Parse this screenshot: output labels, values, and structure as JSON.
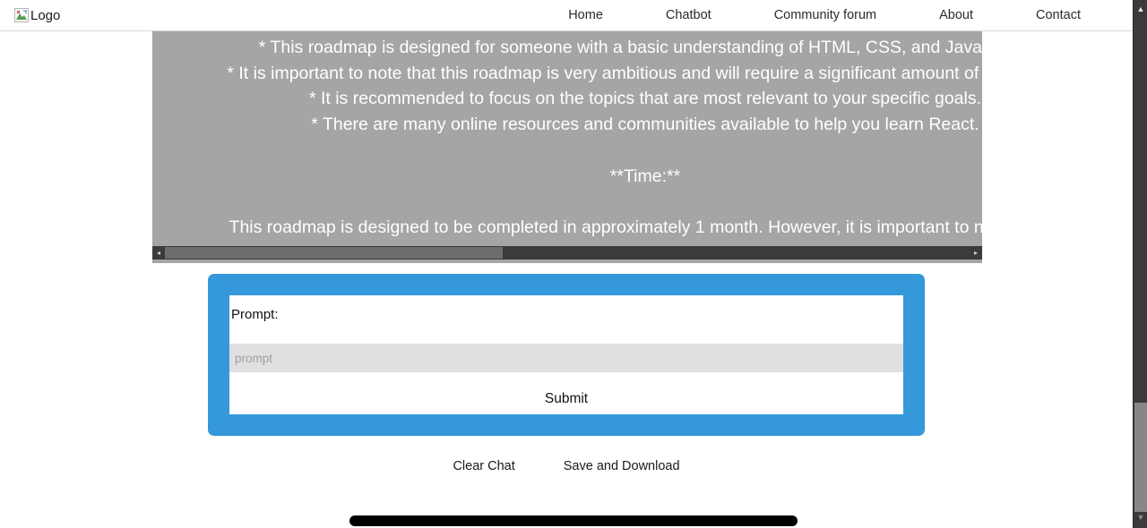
{
  "header": {
    "logo_alt": "Logo",
    "logo_icon": "broken-image-icon",
    "nav": [
      {
        "label": "Home"
      },
      {
        "label": "Chatbot"
      },
      {
        "label": "Community forum"
      },
      {
        "label": "About"
      },
      {
        "label": "Contact"
      }
    ]
  },
  "chat": {
    "lines": [
      "* This roadmap is designed for someone with a basic understanding of HTML, CSS, and JavaScript.",
      "* It is important to note that this roadmap is very ambitious and will require a significant amount of dedication",
      "* It is recommended to focus on the topics that are most relevant to your specific goals.",
      "* There are many online resources and communities available to help you learn React.",
      "",
      "**Time:**",
      "",
      "This roadmap is designed to be completed in approximately 1 month. However, it is important to note that th"
    ],
    "scrollbar": {
      "left_arrow": "◂",
      "right_arrow": "▸",
      "thumb_position_percent": 0
    },
    "background_color": "#a5a5a5",
    "text_color": "#ffffff"
  },
  "form": {
    "card_color": "#3498db",
    "prompt_label": "Prompt:",
    "prompt_value": "",
    "prompt_placeholder": "prompt",
    "submit_label": "Submit"
  },
  "actions": {
    "clear_label": "Clear Chat",
    "save_label": "Save and Download"
  },
  "bottom_bar": {
    "color": "#000000"
  },
  "browser_scrollbar": {
    "up_arrow": "▲",
    "down_arrow": "▼"
  }
}
